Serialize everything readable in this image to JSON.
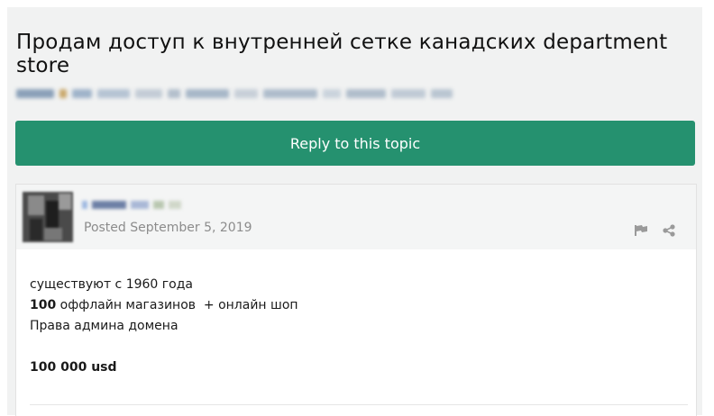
{
  "topic": {
    "title": "Продам доступ к внутренней сетке канадских department store"
  },
  "reply_button": {
    "label": "Reply to this topic"
  },
  "post": {
    "posted_label": "Posted September 5, 2019",
    "icons": {
      "report": "flag-icon",
      "share": "share-icon"
    },
    "body": {
      "line1": "существуют с 1960 года",
      "line2_bold": "100",
      "line2_rest": " оффлайн магазинов  + онлайн шоп",
      "line3": "Права админа домена",
      "price": "100 000 usd"
    }
  },
  "colors": {
    "accent": "#25916f",
    "page_bg": "#f1f2f2",
    "muted_text": "#8c8c8c"
  }
}
